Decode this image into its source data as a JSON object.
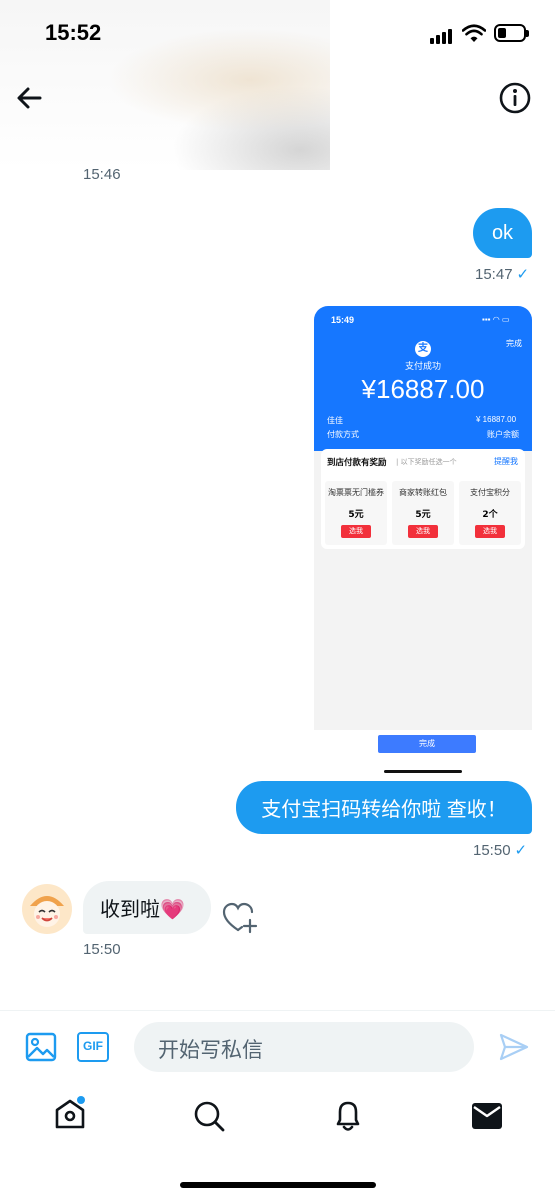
{
  "status_bar": {
    "time": "15:52"
  },
  "header": {
    "back_icon": "arrow-left-icon",
    "info_icon": "info-circle-icon"
  },
  "messages": [
    {
      "dir": "in",
      "kind": "timestamp",
      "time": "15:46"
    },
    {
      "dir": "out",
      "text": "ok",
      "time": "15:47",
      "read": true
    },
    {
      "dir": "out",
      "kind": "image",
      "time": "",
      "read": false
    },
    {
      "dir": "out",
      "text": "支付宝扫码转给你啦 查收！",
      "time": "15:50",
      "read": true
    },
    {
      "dir": "in",
      "text": "收到啦💗",
      "time": "15:50"
    }
  ],
  "screenshot_image": {
    "time": "15:49",
    "done_top": "完成",
    "logo": "支",
    "success": "支付成功",
    "amount": "¥16887.00",
    "payer": "佳佳",
    "payer_amount": "¥ 16887.00",
    "method_label": "付款方式",
    "balance_label": "账户余额",
    "reward_title": "到店付款有奖励",
    "reward_sub": "以下奖励任选一个",
    "remind": "提醒我",
    "options": [
      {
        "name": "淘票票无门槛券",
        "amount": "5元",
        "button": "选我"
      },
      {
        "name": "商家转账红包",
        "amount": "5元",
        "button": "选我"
      },
      {
        "name": "支付宝积分",
        "amount": "2个",
        "button": "选我"
      }
    ],
    "done_bottom": "完成"
  },
  "composer": {
    "placeholder": "开始写私信",
    "image_icon": "image-icon",
    "gif_label": "GIF",
    "send_icon": "send-icon"
  },
  "tabbar": [
    {
      "icon": "home-icon"
    },
    {
      "icon": "search-icon"
    },
    {
      "icon": "bell-icon"
    },
    {
      "icon": "mail-icon"
    }
  ],
  "colors": {
    "accent": "#1d9bf0",
    "alipay_blue": "#1677ff",
    "alipay_red": "#f2303b"
  }
}
